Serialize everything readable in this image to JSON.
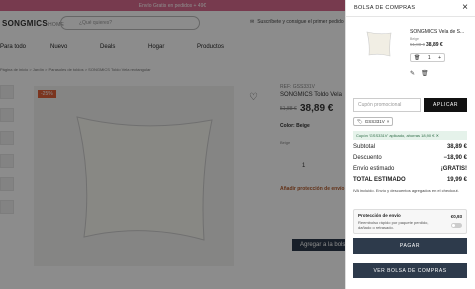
{
  "background": {
    "promo_text": "Envío Gratis en pedidos + 49€",
    "logo": "SONGMICS",
    "logo_sub": "HOME",
    "search_placeholder": "¿Qué quieres?",
    "subscribe_text": "Suscríbete y consigue el primer pedido",
    "nav": [
      "Para todo",
      "Nuevo",
      "Deals",
      "Hogar",
      "Productos"
    ],
    "breadcrumb": "Página de inicio > Jardín > Parasoles de toldos > SONGMICS Toldo Vela rectangular",
    "discount_badge": "-25%",
    "sku": "REF: GSS331V",
    "product_title": "SONGMICS Toldo Vela",
    "old_price": "51,88 €",
    "new_price": "38,89 €",
    "color_label": "Color: Beige",
    "color_value": "Beige",
    "qty": "1",
    "protect_title": "Añadir protección de envío",
    "add_to_cart": "Agregar a la bolsa"
  },
  "cart": {
    "title": "BOLSA DE COMPRAS",
    "item": {
      "name": "SONGMICS Vela de S...",
      "variant": "Beige",
      "old_price": "51,88 €",
      "new_price": "38,89 €",
      "qty": "1"
    },
    "coupon_placeholder": "Cupón promocional",
    "apply_label": "APLICAR",
    "coupon_code": "GSS331V",
    "coupon_message": "Cupón 'GSS331V' aplicado, ahorras 18,90 € ✕",
    "summary": {
      "subtotal_label": "Subtotal",
      "subtotal": "38,89 €",
      "discount_label": "Descuento",
      "discount": "−18,90 €",
      "shipping_label": "Envío estimado",
      "shipping": "¡GRATIS!",
      "total_label": "TOTAL ESTIMADO",
      "total": "19,99 €"
    },
    "tax_note": "IVA incluido. Envío y descuentos agregados en el checkout.",
    "protection": {
      "title": "Protección de envío",
      "desc": "Reembolso rápido por paquete perdido, dañado o retrasado.",
      "price": "€0,93"
    },
    "pay_label": "PAGAR",
    "view_cart_label": "VER BOLSA DE COMPRAS"
  }
}
